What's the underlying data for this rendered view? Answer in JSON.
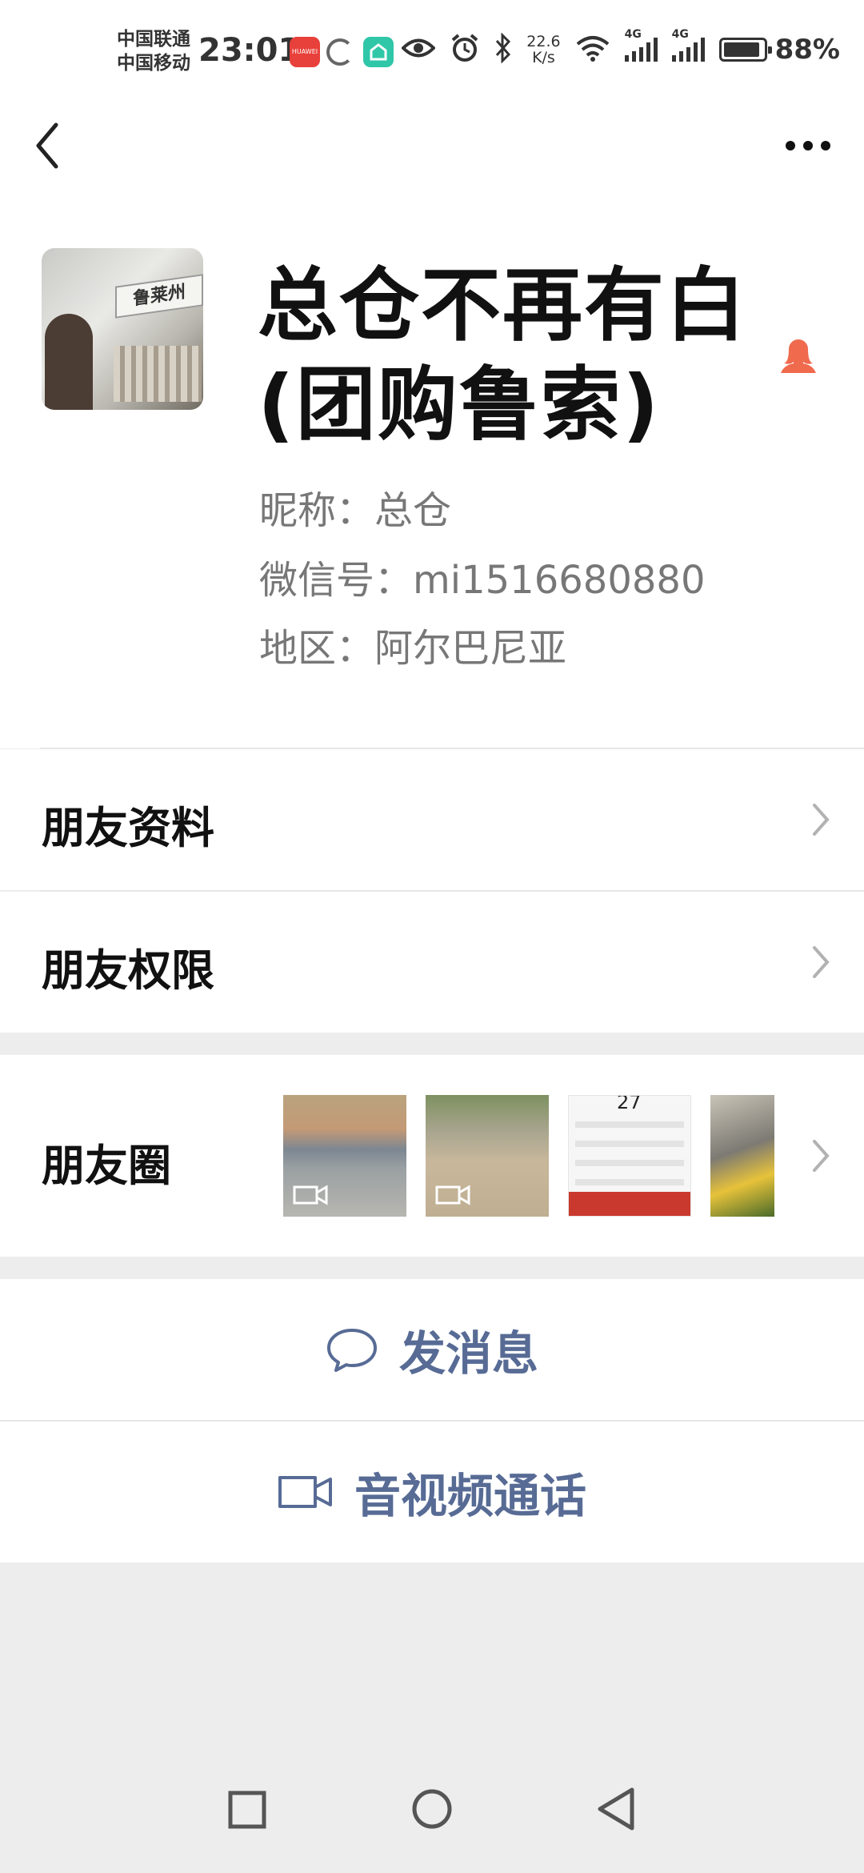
{
  "status_bar": {
    "carrier1": "中国联通",
    "carrier2": "中国移动",
    "time": "23:01",
    "speed_value": "22.6",
    "speed_unit": "K/s",
    "network1": "4G",
    "network2": "4G",
    "battery": "88%",
    "icons": [
      "huawei-appgallery-icon",
      "loading-ring-icon",
      "home-app-icon",
      "eye-icon",
      "alarm-icon",
      "bluetooth-icon",
      "wifi-icon",
      "signal-icon",
      "signal-icon",
      "battery-icon"
    ]
  },
  "header": {
    "back_icon": "chevron-left-icon",
    "more_icon": "more-dots-icon"
  },
  "profile": {
    "name": "总仓不再有白(团购鲁索)",
    "avatar_sign_text": "鲁莱州",
    "gender_icon": "female-person-icon",
    "nickname": "昵称：总仓",
    "wechat_id": "微信号：mi1516680880",
    "region": "地区：阿尔巴尼亚"
  },
  "rows": {
    "friend_info": "朋友资料",
    "friend_permissions": "朋友权限",
    "moments": "朋友圈"
  },
  "moments_thumbs": [
    {
      "kind": "video"
    },
    {
      "kind": "video"
    },
    {
      "kind": "image",
      "top_number": "27"
    },
    {
      "kind": "image"
    }
  ],
  "actions": {
    "send_message": "发消息",
    "av_call": "音视频通话"
  },
  "colors": {
    "link_blue": "#576b95",
    "gender_orange": "#f06a4e",
    "background": "#ededed"
  }
}
